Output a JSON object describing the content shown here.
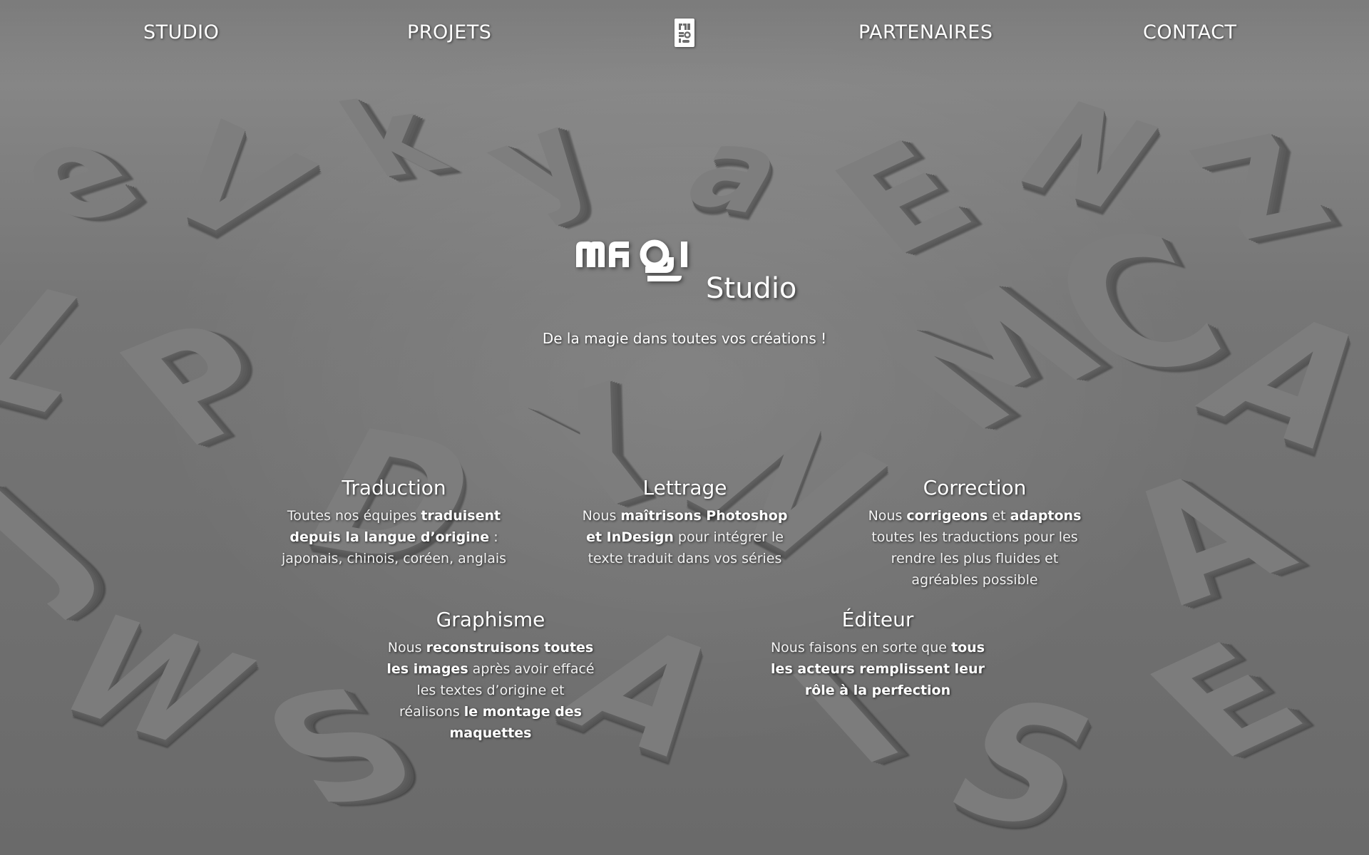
{
  "nav": {
    "studio": "STUDIO",
    "projets": "PROJETS",
    "partenaires": "PARTENAIRES",
    "contact": "CONTACT"
  },
  "hero": {
    "brand": "magi",
    "subtitle": "Studio",
    "tagline": "De la magie dans toutes vos créations !"
  },
  "services": {
    "traduction": {
      "title": "Traduction",
      "t1": "Toutes nos équipes ",
      "b1": "traduisent depuis la langue d’origine",
      "t2": " : japonais, chinois, coréen, anglais"
    },
    "lettrage": {
      "title": "Lettrage",
      "t1": "Nous ",
      "b1": "maîtrisons Photoshop et InDesign",
      "t2": " pour intégrer le texte traduit dans vos séries"
    },
    "correction": {
      "title": "Correction",
      "t1": "Nous ",
      "b1": "corrigeons",
      "t2": " et ",
      "b2": "adaptons",
      "t3": " toutes les traductions pour les rendre les plus fluides et agréables possible"
    },
    "graphisme": {
      "title": "Graphisme",
      "t1": "Nous ",
      "b1": "reconstruisons toutes les images",
      "t2": " après avoir effacé les textes d’origine et réalisons ",
      "b2": "le montage des maquettes"
    },
    "editeur": {
      "title": "Éditeur",
      "t1": "Nous faisons en sorte que ",
      "b1": "tous les acteurs remplissent leur rôle à la perfection"
    }
  },
  "colors": {
    "background": "#6d6d6d",
    "text": "#ffffff"
  }
}
